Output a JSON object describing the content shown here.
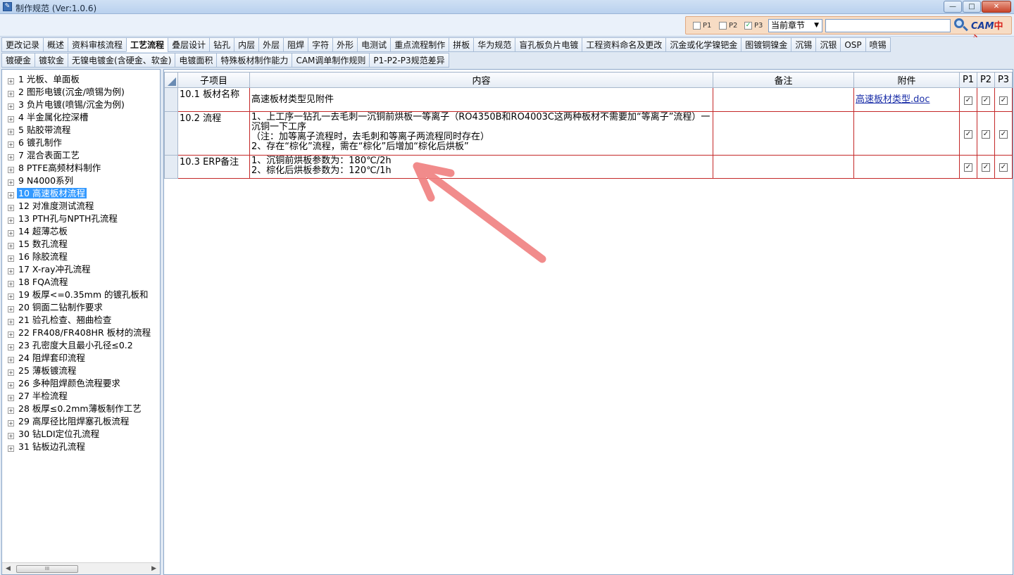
{
  "window": {
    "title": "制作规范 (Ver:1.0.6)",
    "icon": "app-icon",
    "buttons": {
      "minimize": "—",
      "maximize": "□",
      "close": "✕"
    }
  },
  "filter": {
    "p1": "P1",
    "p2": "P2",
    "p3": "P3",
    "p1_checked": false,
    "p2_checked": false,
    "p3_checked": true,
    "chapter_select": "当前章节",
    "search_placeholder": "",
    "logo_cam": "CAM",
    "logo_cn": "中心"
  },
  "tabs_row1": [
    "更改记录",
    "概述",
    "资料审核流程",
    "工艺流程",
    "叠层设计",
    "钻孔",
    "内层",
    "外层",
    "阻焊",
    "字符",
    "外形",
    "电测试",
    "重点流程制作",
    "拼板",
    "华为规范",
    "盲孔板负片电镀",
    "工程资料命名及更改",
    "沉金或化学镍钯金",
    "图镀铜镍金",
    "沉锡",
    "沉银",
    "OSP",
    "喷锡"
  ],
  "tabs_row2": [
    "镀硬金",
    "镀软金",
    "无镍电镀金(含硬金、软金)",
    "电镀面积",
    "特殊板材制作能力",
    "CAM调单制作规则",
    "P1-P2-P3规范差异"
  ],
  "active_tab": "工艺流程",
  "tree": [
    "1 光板、单面板",
    "2 图形电镀(沉金/喷锡为例)",
    "3 负片电镀(喷锡/沉金为例)",
    "4 半金属化控深槽",
    "5 贴胶带流程",
    "6 镀孔制作",
    "7 混合表面工艺",
    "8 PTFE高频材料制作",
    "9 N4000系列",
    "10 高速板材流程",
    "12 对准度测试流程",
    "13 PTH孔与NPTH孔流程",
    "14 超薄芯板",
    "15 数孔流程",
    "16 除胶流程",
    "17 X-ray冲孔流程",
    "18 FQA流程",
    "19 板厚<=0.35mm 的镀孔板和",
    "20 铜面二钻制作要求",
    "21 验孔检查、翘曲检查",
    "22 FR408/FR408HR 板材的流程",
    "23 孔密度大且最小孔径≤0.2",
    "24 阻焊套印流程",
    "25 薄板镀流程",
    "26 多种阻焊颜色流程要求",
    "27 半检流程",
    "28 板厚≤0.2mm薄板制作工艺",
    "29 高厚径比阻焊塞孔板流程",
    "30 钻LDI定位孔流程",
    "31 钻板边孔流程"
  ],
  "tree_selected_index": 9,
  "grid": {
    "headers": {
      "sub": "子项目",
      "content": "内容",
      "note": "备注",
      "attach": "附件",
      "p1": "P1",
      "p2": "P2",
      "p3": "P3"
    },
    "rows": [
      {
        "sub": "10.1 板材名称",
        "content": [
          "高速板材类型见附件"
        ],
        "note": "",
        "attach": "高速板材类型.doc",
        "p1": true,
        "p2": true,
        "p3": true
      },
      {
        "sub": "10.2 流程",
        "content": [
          "1、上工序一钻孔一去毛刺一沉铜前烘板一等离子（RO4350B和RO4003C这两种板材不需要加“等离子”流程）一沉铜一下工序",
          "（注：加等离子流程时，去毛刺和等离子两流程同时存在）",
          "2、存在“棕化”流程，需在“棕化”后增加“棕化后烘板”"
        ],
        "note": "",
        "attach": "",
        "p1": true,
        "p2": true,
        "p3": true
      },
      {
        "sub": "10.3 ERP备注",
        "content": [
          "1、沉铜前烘板参数为：180℃/2h",
          "2、棕化后烘板参数为：120℃/1h"
        ],
        "note": "",
        "attach": "",
        "p1": true,
        "p2": true,
        "p3": true
      }
    ]
  },
  "colors": {
    "accent": "#3399ff",
    "row_border": "#c42828",
    "annotation_arrow": "#f08282"
  },
  "scroll_glyph": "III"
}
